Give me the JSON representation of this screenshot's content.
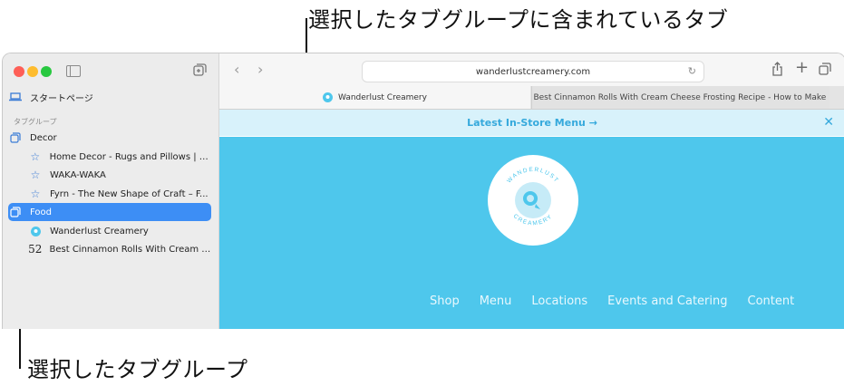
{
  "annotations": {
    "top": "選択したタブグループに含まれているタブ",
    "bottom": "選択したタブグループ"
  },
  "sidebar": {
    "start_page": "スタートページ",
    "section_label": "タブグループ",
    "groups": [
      {
        "label": "Decor"
      },
      {
        "label": "Food"
      }
    ],
    "decor_tabs": [
      {
        "label": "Home Decor - Rugs and Pillows | M..."
      },
      {
        "label": "WAKA-WAKA"
      },
      {
        "label": "Fyrn - The New Shape of Craft – F..."
      }
    ],
    "food_tabs": [
      {
        "label": "Wanderlust Creamery"
      },
      {
        "label": "Best Cinnamon Rolls With Cream C...",
        "icon_text": "52"
      }
    ]
  },
  "toolbar": {
    "url": "wanderlustcreamery.com"
  },
  "tabs": [
    {
      "label": "Wanderlust Creamery",
      "active": true
    },
    {
      "label": "Best Cinnamon Rolls With Cream Cheese Frosting Recipe - How to Make Ho...",
      "icon_text": "52",
      "active": false
    }
  ],
  "page": {
    "banner_text": "Latest In-Store Menu  →",
    "banner_close": "✕",
    "logo_top": "WANDERLUST",
    "logo_bottom": "CREAMERY",
    "nav": [
      "Shop",
      "Menu",
      "Locations",
      "Events and Catering",
      "Content"
    ]
  },
  "colors": {
    "accent_selected": "#3d8ef5",
    "hero_bg": "#4ec7ec",
    "banner_bg": "#d8f2fb",
    "banner_text": "#35a9dc"
  },
  "icons": {
    "sidebar_group": "tab-group-icon",
    "bookmark": "star-icon",
    "start_page": "laptop-icon",
    "new_tab_group": "new-tab-group-icon",
    "share": "share-icon",
    "new_tab": "plus-icon",
    "tab_overview": "tab-overview-icon",
    "reload": "reload-icon"
  }
}
